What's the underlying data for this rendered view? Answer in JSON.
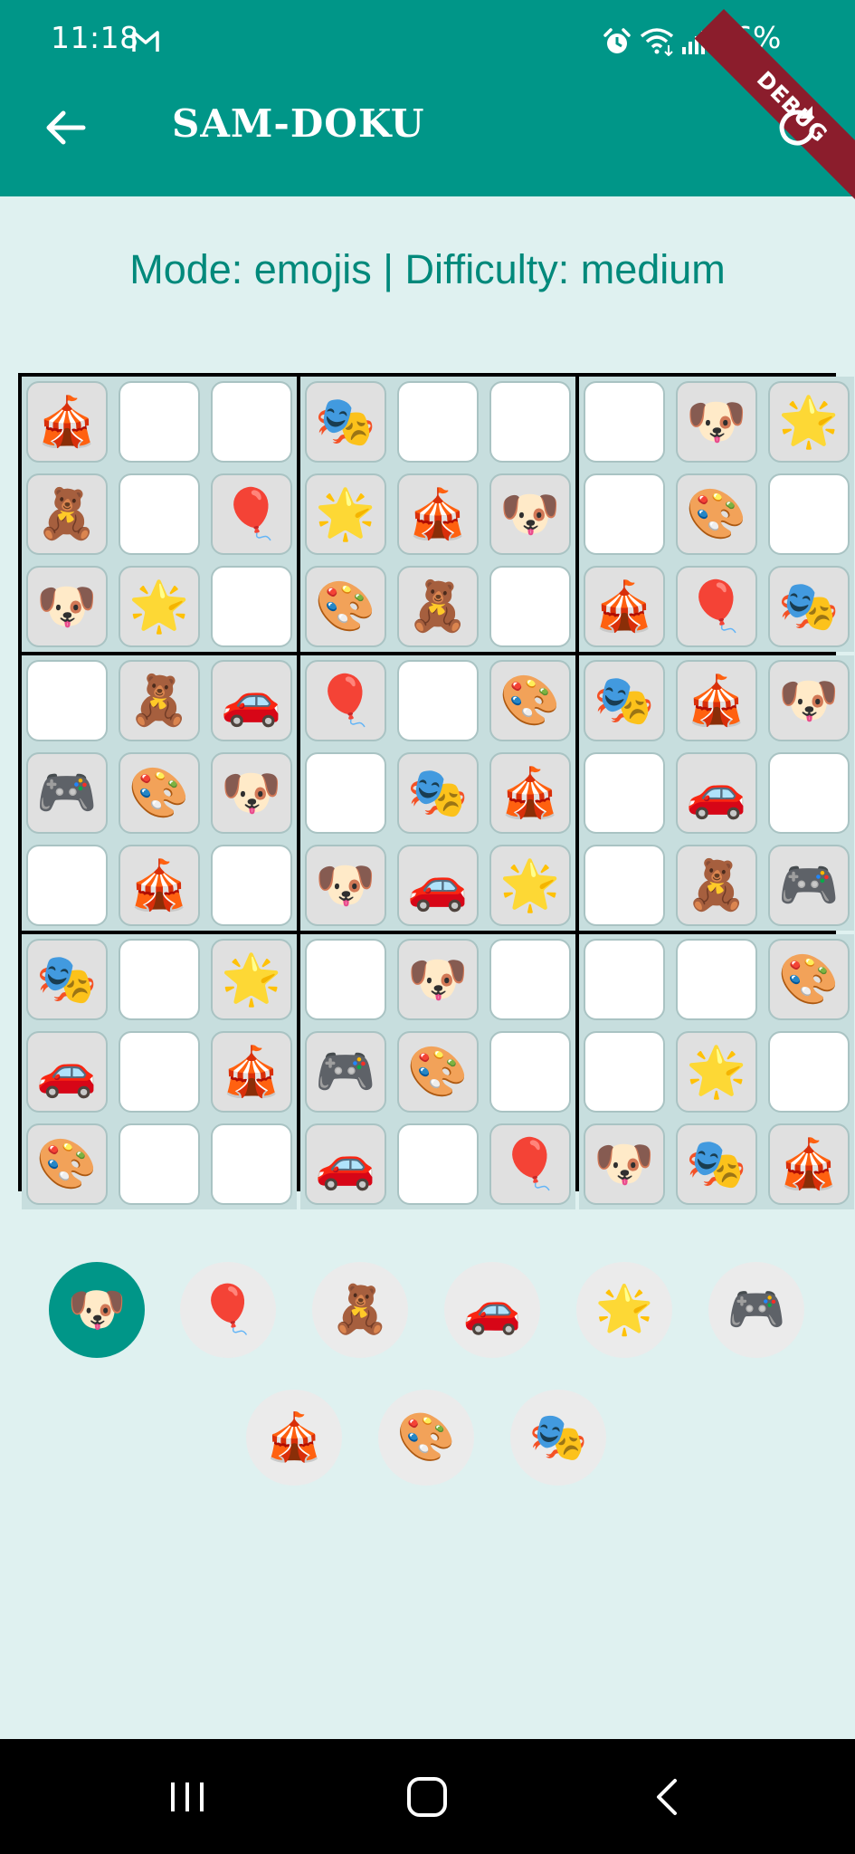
{
  "status_bar": {
    "time": "11:18",
    "battery": "46%"
  },
  "debug_banner": "DEBUG",
  "app_bar": {
    "title": "SAM-DOKU"
  },
  "mode_line": "Mode: emojis | Difficulty: medium",
  "board": {
    "grid": [
      [
        "🎪",
        "",
        "",
        "🎭",
        "",
        "",
        "",
        "🐶",
        "🌟"
      ],
      [
        "🧸",
        "",
        "🎈",
        "🌟",
        "🎪",
        "🐶",
        "",
        "🎨",
        ""
      ],
      [
        "🐶",
        "🌟",
        "",
        "🎨",
        "🧸",
        "",
        "🎪",
        "🎈",
        "🎭"
      ],
      [
        "",
        "🧸",
        "🚗",
        "🎈",
        "",
        "🎨",
        "🎭",
        "🎪",
        "🐶"
      ],
      [
        "🎮",
        "🎨",
        "🐶",
        "",
        "🎭",
        "🎪",
        "",
        "🚗",
        ""
      ],
      [
        "",
        "🎪",
        "",
        "🐶",
        "🚗",
        "🌟",
        "",
        "🧸",
        "🎮"
      ],
      [
        "🎭",
        "",
        "🌟",
        "",
        "🐶",
        "",
        "",
        "",
        "🎨"
      ],
      [
        "🚗",
        "",
        "🎪",
        "🎮",
        "🎨",
        "",
        "",
        "🌟",
        ""
      ],
      [
        "🎨",
        "",
        "",
        "🚗",
        "",
        "🎈",
        "🐶",
        "🎭",
        "🎪"
      ]
    ]
  },
  "palette": {
    "selected": 0,
    "items": [
      {
        "emoji": "🐶",
        "name": "dog"
      },
      {
        "emoji": "🎈",
        "name": "balloon"
      },
      {
        "emoji": "🧸",
        "name": "teddy-bear"
      },
      {
        "emoji": "🚗",
        "name": "car"
      },
      {
        "emoji": "🌟",
        "name": "star"
      },
      {
        "emoji": "🎮",
        "name": "game-controller"
      },
      {
        "emoji": "🎪",
        "name": "circus-tent"
      },
      {
        "emoji": "🎨",
        "name": "palette"
      },
      {
        "emoji": "🎭",
        "name": "performing-arts"
      }
    ]
  },
  "colors": {
    "primary": "#009688",
    "background": "#dff1f0",
    "mode_text": "#00897b",
    "given_cell": "#e0e0e0",
    "empty_cell": "#ffffff",
    "debug_banner": "#8b1d2c"
  }
}
